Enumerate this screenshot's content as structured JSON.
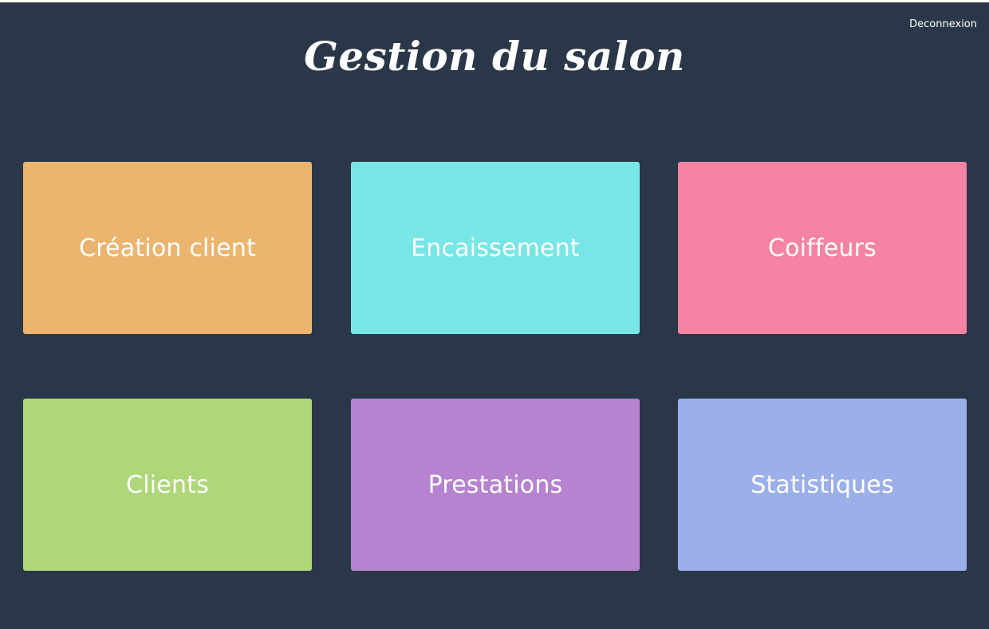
{
  "header": {
    "title": "Gestion du salon",
    "logout_label": "Deconnexion"
  },
  "tiles": [
    {
      "label": "Création client",
      "color": "#ebb570"
    },
    {
      "label": "Encaissement",
      "color": "#78e6e7"
    },
    {
      "label": "Coiffeurs",
      "color": "#f584a4"
    },
    {
      "label": "Clients",
      "color": "#afd679"
    },
    {
      "label": "Prestations",
      "color": "#b683d0"
    },
    {
      "label": "Statistiques",
      "color": "#9bb0ea"
    }
  ]
}
